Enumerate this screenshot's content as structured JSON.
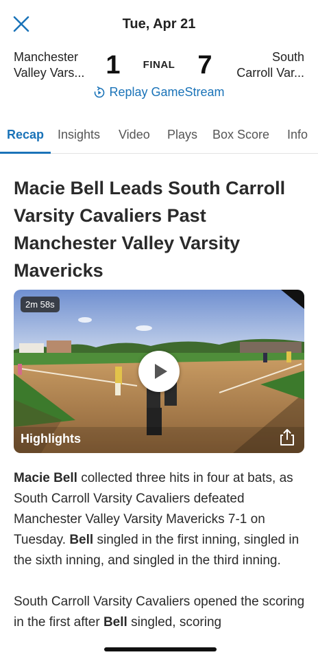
{
  "header": {
    "date": "Tue, Apr 21",
    "close_icon": "close-icon"
  },
  "score": {
    "home_team": "Manchester Valley Vars...",
    "home_team_line1": "Manchester",
    "home_team_line2": "Valley Vars...",
    "home_score": "1",
    "status": "FINAL",
    "away_score": "7",
    "away_team_line1": "South",
    "away_team_line2": "Carroll Var..."
  },
  "replay": {
    "label": "Replay GameStream",
    "icon": "replay-icon"
  },
  "tabs": [
    {
      "label": "Recap",
      "active": true
    },
    {
      "label": "Insights",
      "active": false
    },
    {
      "label": "Video",
      "active": false
    },
    {
      "label": "Plays",
      "active": false
    },
    {
      "label": "Box Score",
      "active": false
    },
    {
      "label": "Info",
      "active": false
    }
  ],
  "article": {
    "headline": "Macie Bell Leads South Carroll Varsity Cavaliers Past Manchester Valley Varsity Mavericks",
    "video": {
      "duration": "2m 58s",
      "label": "Highlights",
      "play_icon": "play-icon",
      "share_icon": "share-icon"
    },
    "p1": {
      "bold1": "Macie Bell",
      "text1": " collected three hits in four at bats, as South Carroll Varsity Cavaliers defeated Manchester Valley Varsity Mavericks 7-1 on Tuesday. ",
      "bold2": "Bell",
      "text2": " singled in the first inning, singled in the sixth inning, and singled in the third inning."
    },
    "p2": {
      "text1": "South Carroll Varsity Cavaliers opened the scoring in the first after ",
      "bold1": "Bell",
      "text2": " singled, scoring"
    }
  },
  "colors": {
    "accent": "#1a73b8",
    "text": "#2a2a2a"
  }
}
